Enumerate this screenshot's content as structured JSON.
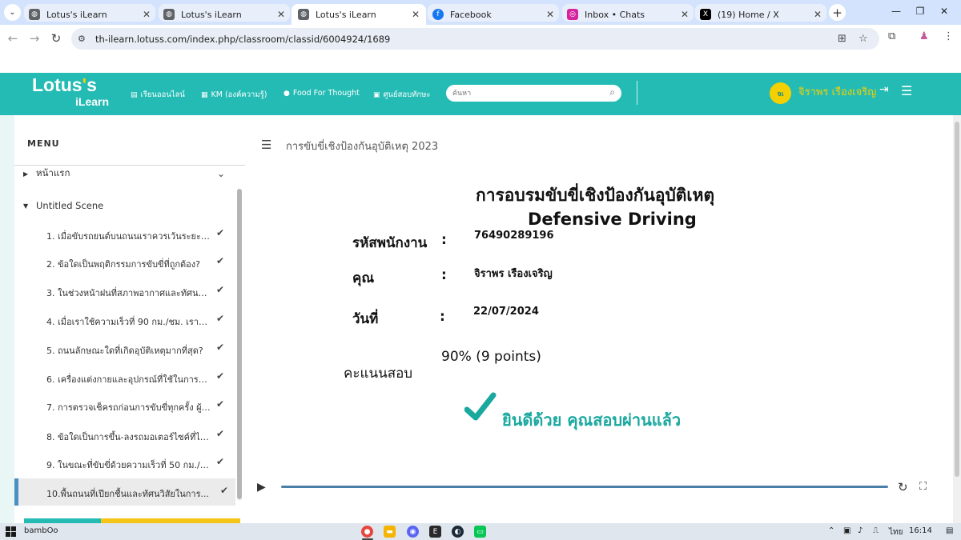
{
  "browser": {
    "tabs": [
      {
        "title": "Lotus's iLearn",
        "favicon": "globe-icon",
        "active": false
      },
      {
        "title": "Lotus's iLearn",
        "favicon": "globe-icon",
        "active": false
      },
      {
        "title": "Lotus's iLearn",
        "favicon": "globe-icon",
        "active": true
      },
      {
        "title": "Facebook",
        "favicon": "facebook-icon",
        "active": false
      },
      {
        "title": "Inbox • Chats",
        "favicon": "instagram-icon",
        "active": false
      },
      {
        "title": "(19) Home / X",
        "favicon": "x-icon",
        "active": false
      }
    ],
    "url": "th-ilearn.lotuss.com/index.php/classroom/classid/6004924/1689"
  },
  "site": {
    "logo_text": "Lotus",
    "logo_apos": "'",
    "logo_s": "s",
    "logo_sub": "iLearn",
    "nav": [
      "เรียนออนไลน์",
      "KM (องค์ความรู้)",
      "Food For Thought",
      "ศูนย์สอบทักษะ"
    ],
    "search_placeholder": "ค้นหา",
    "avatar_initials": "จเ",
    "user_name": "จิราพร เรืองเจริญ",
    "brand_color": "#24bbb4",
    "accent_color": "#f5d000"
  },
  "sidebar": {
    "title": "MENU",
    "sections": [
      {
        "label": "หน้าแรก",
        "expanded": false,
        "completed": true
      },
      {
        "label": "Untitled Scene",
        "expanded": true,
        "completed": false
      }
    ],
    "items": [
      {
        "label": "1. เมื่อขับรถยนต์บนถนนเราควรเว้นระยะห่าง...",
        "completed": true
      },
      {
        "label": "2. ข้อใดเป็นพฤติกรรมการขับขี่ที่ถูกต้อง?",
        "completed": true
      },
      {
        "label": "3. ในช่วงหน้าฝนที่สภาพอากาศและทัศนวิ...",
        "completed": true
      },
      {
        "label": "4. เมื่อเราใช้ความเร็วที่ 90 กม./ชม. เราต้อง...",
        "completed": true
      },
      {
        "label": "5. ถนนลักษณะใดที่เกิดอุบัติเหตุมากที่สุด?",
        "completed": true
      },
      {
        "label": "6. เครื่องแต่งกายและอุปกรณ์ที่ใช้ในการขั...",
        "completed": true
      },
      {
        "label": "7. การตรวจเช็ครถก่อนการขับขี่ทุกครั้ง ผู้ขั...",
        "completed": true
      },
      {
        "label": "8. ข้อใดเป็นการขึ้น-ลงรถมอเตอร์ไซค์ที่ไม่...",
        "completed": true
      },
      {
        "label": "9. ในขณะที่ขับขี่ด้วยความเร็วที่ 50 กม./ ช...",
        "completed": true
      },
      {
        "label": "10.พื้นถนนที่เปียกชื้นและทัศนวิสัยในการ...",
        "completed": true,
        "current": true
      }
    ]
  },
  "slide": {
    "breadcrumb": "การขับขี่เชิงป้องกันอุบัติเหตุ 2023",
    "title_th": "การอบรมขับขี่เชิงป้องกันอุบัติเหตุ",
    "title_en": "Defensive Driving",
    "fields": [
      {
        "label": "รหัสพนักงาน",
        "colon": ":",
        "value": "76490289196"
      },
      {
        "label": "คุณ",
        "colon": ":",
        "value": "จิราพร เรืองเจริญ"
      },
      {
        "label": "วันที่",
        "colon": ":",
        "value": "22/07/2024"
      }
    ],
    "score_label": "คะแนนสอบ",
    "score_value": "90% (9 points)",
    "pass_message": "ยินดีด้วย คุณสอบผ่านแล้ว",
    "pass_color": "#1aa89f",
    "player_progress": 1.0
  },
  "taskbar": {
    "search_label": "bambOo",
    "apps": [
      "chrome-icon",
      "file-explorer-icon",
      "discord-icon",
      "epic-games-icon",
      "steam-icon",
      "line-icon"
    ],
    "lang": "ไทย",
    "time": "16:14"
  }
}
